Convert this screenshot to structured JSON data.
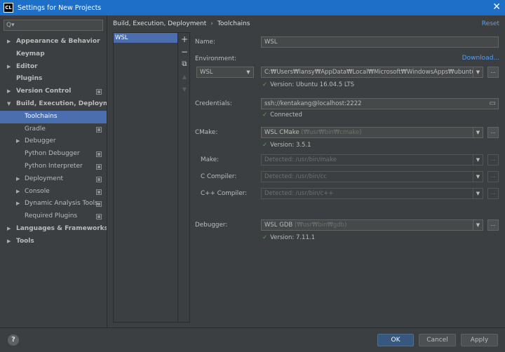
{
  "window": {
    "app_icon": "CL",
    "title": "Settings for New Projects",
    "close": "✕"
  },
  "search": {
    "icon": "Q▾"
  },
  "sidebar": {
    "items": [
      {
        "label": "Appearance & Behavior"
      },
      {
        "label": "Keymap"
      },
      {
        "label": "Editor"
      },
      {
        "label": "Plugins"
      },
      {
        "label": "Version Control"
      },
      {
        "label": "Build, Execution, Deployment"
      },
      {
        "label": "Toolchains"
      },
      {
        "label": "Gradle"
      },
      {
        "label": "Debugger"
      },
      {
        "label": "Python Debugger"
      },
      {
        "label": "Python Interpreter"
      },
      {
        "label": "Deployment"
      },
      {
        "label": "Console"
      },
      {
        "label": "Dynamic Analysis Tools"
      },
      {
        "label": "Required Plugins"
      },
      {
        "label": "Languages & Frameworks"
      },
      {
        "label": "Tools"
      }
    ]
  },
  "breadcrumb": {
    "parent": "Build, Execution, Deployment",
    "sep": "›",
    "current": "Toolchains"
  },
  "reset_label": "Reset",
  "toolchains": {
    "items": [
      "WSL"
    ],
    "add": "+",
    "remove": "−",
    "copy": "⧉",
    "up": "▲",
    "down": "▼"
  },
  "form": {
    "name_label": "Name:",
    "name_value": "WSL",
    "environment_label": "Environment:",
    "download_link": "Download...",
    "environment_value": "WSL",
    "environment_path": "C:₩Users₩lansy₩AppData₩Local₩Microsoft₩WindowsApps₩ubuntu.exe",
    "environment_version": "Version: Ubuntu 16.04.5 LTS",
    "credentials_label": "Credentials:",
    "credentials_value": "ssh://kentakang@localhost:2222",
    "credentials_status": "Connected",
    "cmake_label": "CMake:",
    "cmake_value": "WSL CMake",
    "cmake_hint": "(₩usr₩bin₩cmake)",
    "cmake_version": "Version: 3.5.1",
    "make_label": "Make:",
    "make_value": "Detected: /usr/bin/make",
    "c_compiler_label": "C Compiler:",
    "c_compiler_value": "Detected: /usr/bin/cc",
    "cpp_compiler_label": "C++ Compiler:",
    "cpp_compiler_value": "Detected: /usr/bin/c++",
    "debugger_label": "Debugger:",
    "debugger_value": "WSL GDB",
    "debugger_hint": "(₩usr₩bin₩gdb)",
    "debugger_version": "Version: 7.11.1",
    "checkmark": "✓",
    "ellipsis": "...",
    "dd_arrow": "▼",
    "folder_icon": "▭"
  },
  "footer": {
    "help": "?",
    "ok": "OK",
    "cancel": "Cancel",
    "apply": "Apply"
  }
}
